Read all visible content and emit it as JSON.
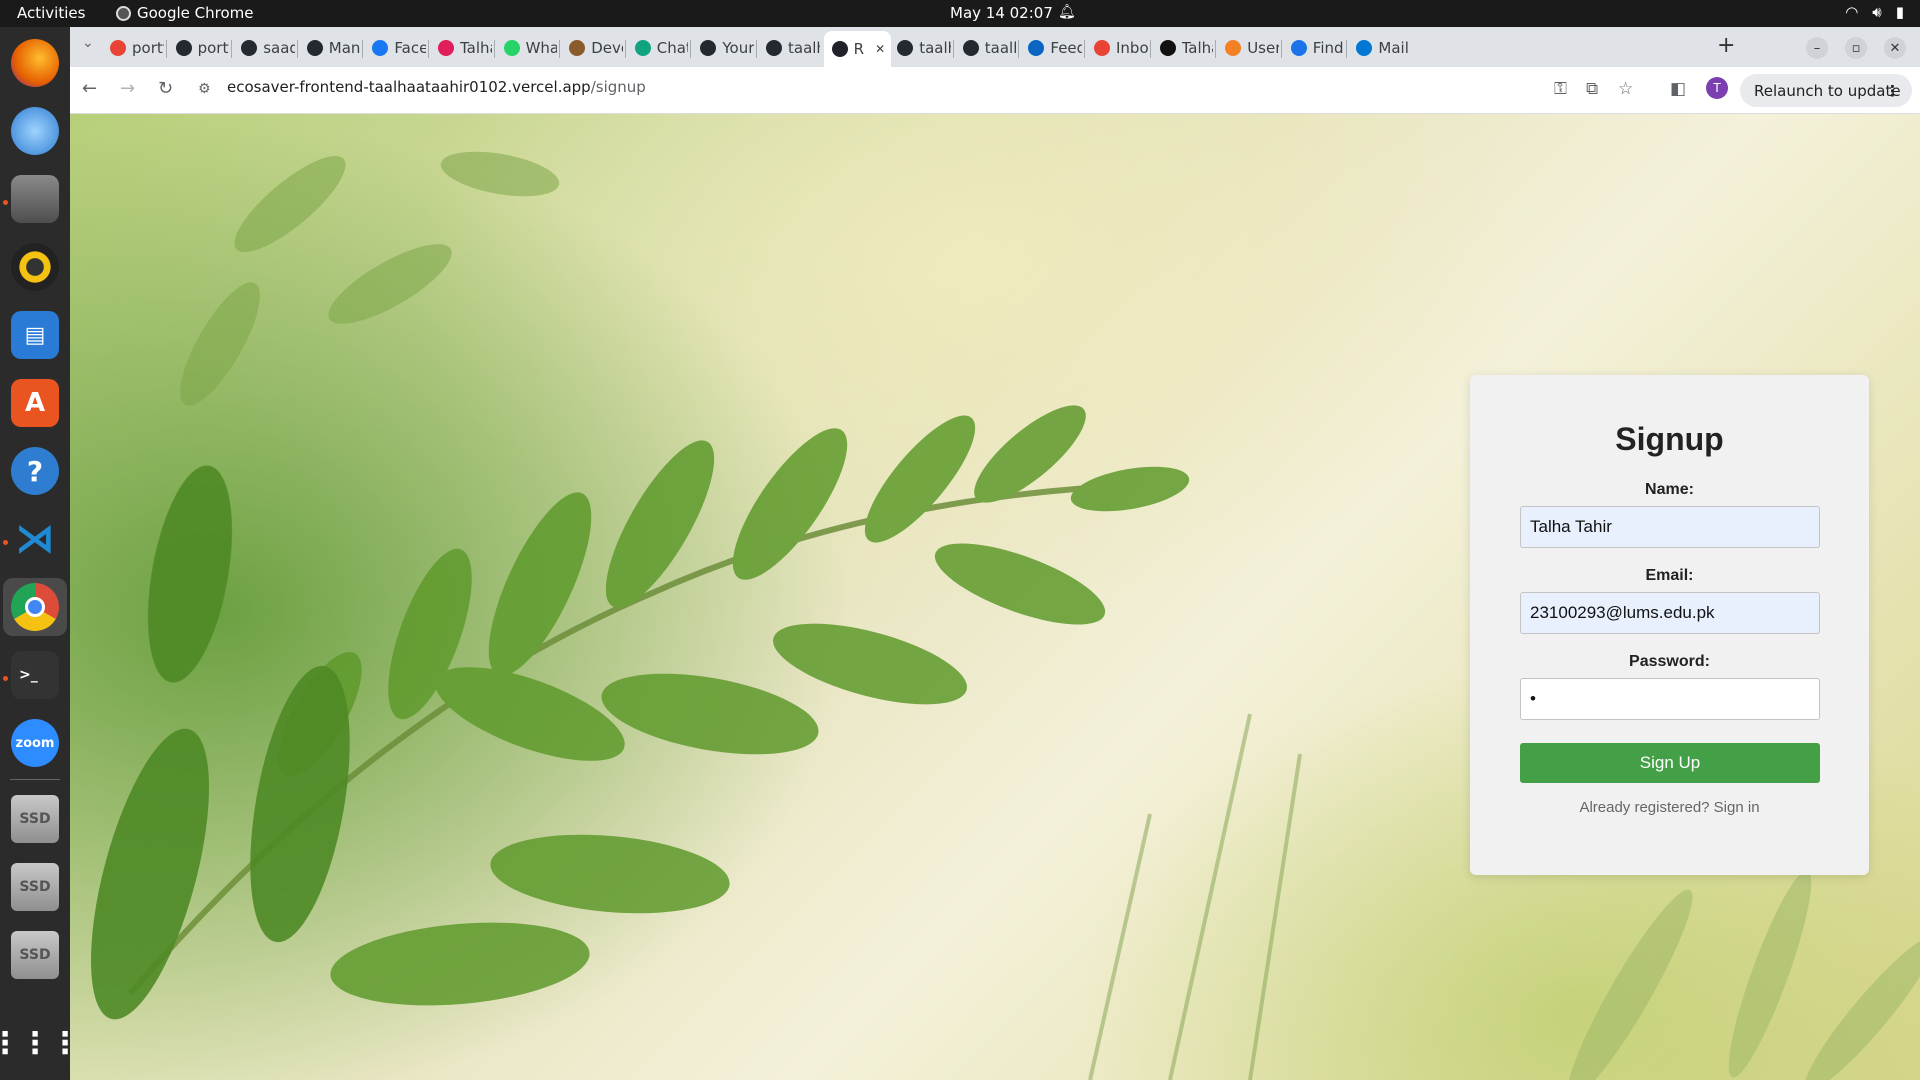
{
  "topbar": {
    "activities": "Activities",
    "app_name": "Google Chrome",
    "clock": "May 14  02:07"
  },
  "dock": {
    "items": [
      {
        "icon": "firefox-icon",
        "color": "#e66000"
      },
      {
        "icon": "thunderbird-icon",
        "color": "#2f7dd1"
      },
      {
        "icon": "files-icon",
        "color": "#5c5c5c"
      },
      {
        "icon": "rhythmbox-icon",
        "color": "#f5c211"
      },
      {
        "icon": "writer-icon",
        "color": "#2a7bd6"
      },
      {
        "icon": "app-center-icon",
        "color": "#e95420"
      },
      {
        "icon": "help-icon",
        "color": "#2f7dd1"
      },
      {
        "icon": "vscode-icon",
        "color": "#1f8ad2"
      },
      {
        "icon": "chrome-icon",
        "color": "#dd4b39"
      },
      {
        "icon": "terminal-icon",
        "color": "#333333"
      },
      {
        "icon": "zoom-icon",
        "color": "#2d8cff",
        "label": "zoom"
      },
      {
        "icon": "ssd-drive-icon",
        "label": "SSD"
      },
      {
        "icon": "ssd-drive-icon",
        "label": "SSD"
      },
      {
        "icon": "ssd-drive-icon",
        "label": "SSD"
      }
    ]
  },
  "tabs": [
    {
      "label": "portf",
      "icon": "google-icon"
    },
    {
      "label": "portf",
      "icon": "github-icon"
    },
    {
      "label": "saad",
      "icon": "github-icon"
    },
    {
      "label": "Mana",
      "icon": "github-icon"
    },
    {
      "label": "Facel",
      "icon": "facebook-icon"
    },
    {
      "label": "Talha",
      "icon": "slack-icon"
    },
    {
      "label": "What",
      "icon": "whatsapp-icon"
    },
    {
      "label": "Deve",
      "icon": "dev-icon"
    },
    {
      "label": "Chat",
      "icon": "chatgpt-icon"
    },
    {
      "label": "Your",
      "icon": "github-icon"
    },
    {
      "label": "taalh",
      "icon": "github-icon"
    },
    {
      "label": "R",
      "icon": "react-icon",
      "active": true
    },
    {
      "label": "taalh",
      "icon": "github-icon"
    },
    {
      "label": "taalh",
      "icon": "github-icon"
    },
    {
      "label": "Feed",
      "icon": "linkedin-icon"
    },
    {
      "label": "Inbo",
      "icon": "gmail-icon"
    },
    {
      "label": "Talha",
      "icon": "medium-icon"
    },
    {
      "label": "User",
      "icon": "stackoverflow-icon"
    },
    {
      "label": "Find",
      "icon": "flag-icon"
    },
    {
      "label": "Mail",
      "icon": "outlook-icon"
    }
  ],
  "address_bar": {
    "host": "ecosaver-frontend-taalhaataahir0102.vercel.app",
    "path": "/signup"
  },
  "toolbar": {
    "avatar_letter": "T",
    "relaunch_label": "Relaunch to update"
  },
  "form": {
    "title": "Signup",
    "name_label": "Name:",
    "name_value": "Talha Tahir",
    "email_label": "Email:",
    "email_value": "23100293@lums.edu.pk",
    "password_label": "Password:",
    "password_value": "•",
    "submit_label": "Sign Up",
    "signin_text": "Already registered? Sign in"
  },
  "colors": {
    "button_green": "#43a047",
    "autofill_blue": "#e8f0fe"
  }
}
